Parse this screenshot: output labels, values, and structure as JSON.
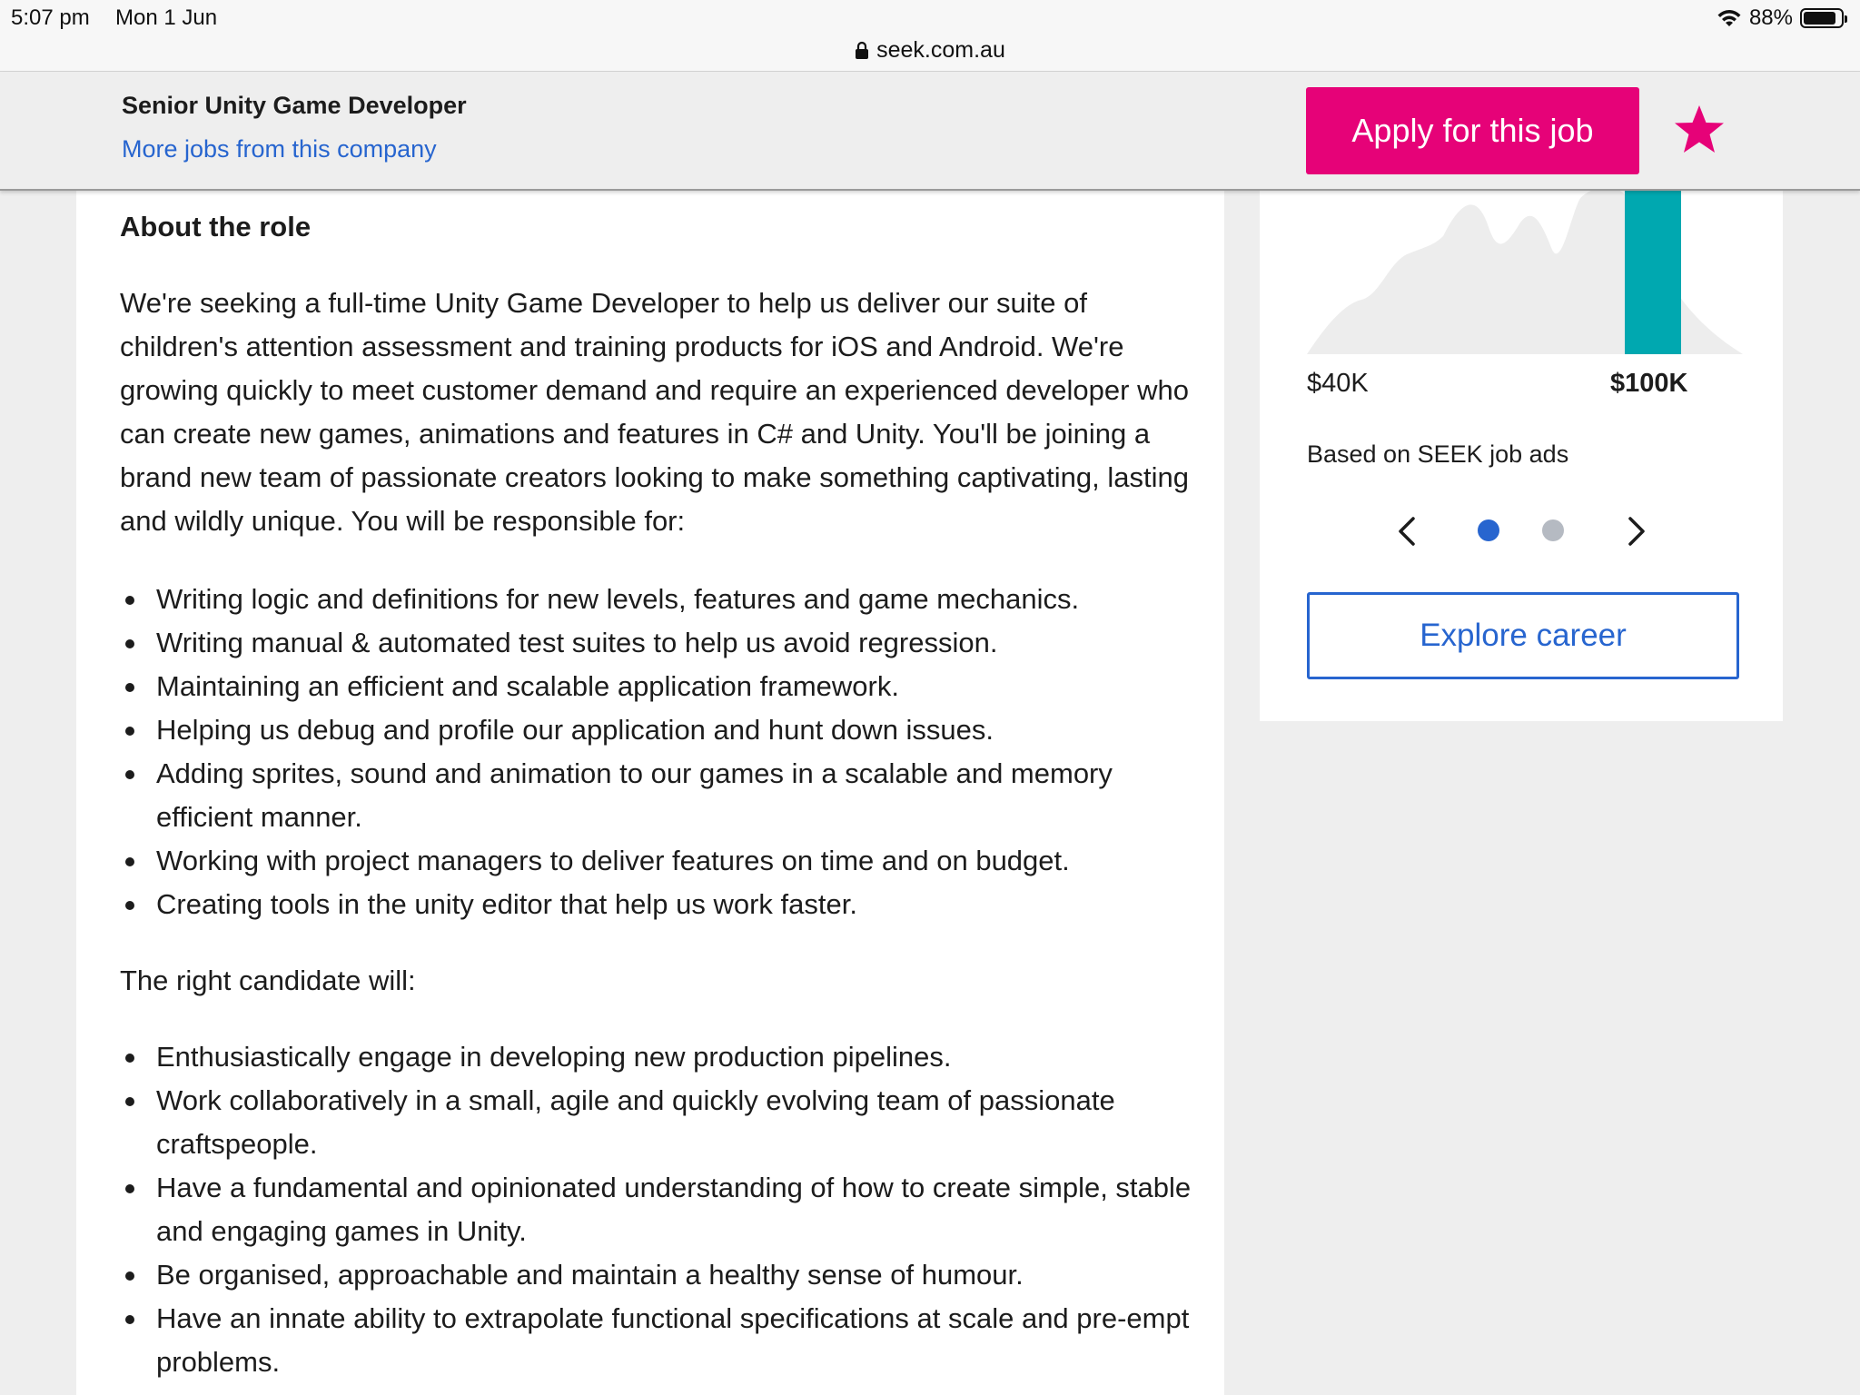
{
  "status_bar": {
    "time": "5:07 pm",
    "date": "Mon 1 Jun",
    "battery": "88%",
    "battery_level": 0.88,
    "url": "seek.com.au"
  },
  "header": {
    "job_title": "Senior Unity Game Developer",
    "company_link": "More jobs from this company",
    "apply_label": "Apply for this job",
    "accent_color": "#e60278",
    "link_color": "#2765cf"
  },
  "content": {
    "section_title": "About the role",
    "intro": "We're seeking a full-time Unity Game Developer to help us deliver our suite of children's attention assessment and training products for iOS and Android. We're growing quickly to meet customer demand and require an experienced developer who can create new games, animations and features in C# and Unity. You'll be joining a brand new team of passionate creators looking to make something captivating, lasting and wildly unique. You will be responsible for:",
    "responsibilities": [
      "Writing logic and definitions for new levels, features and game mechanics.",
      "Writing manual & automated test suites to help us avoid regression.",
      "Maintaining an efficient and scalable application framework.",
      "Helping us debug and profile our application and hunt down issues.",
      "Adding sprites, sound and animation to our games in a scalable and memory efficient manner.",
      "Working with project managers to deliver features on time and on budget.",
      "Creating tools in the unity editor that help us work faster."
    ],
    "candidate_intro": "The right candidate will:",
    "candidate_points": [
      "Enthusiastically engage in developing new production pipelines.",
      "Work collaboratively in a small, agile and quickly evolving team of passionate craftspeople.",
      "Have a fundamental and opinionated understanding of how to create simple, stable and engaging games in Unity.",
      "Be organised, approachable and maintain a healthy sense of humour.",
      "Have an innate ability to extrapolate functional specifications at scale and pre-empt problems."
    ]
  },
  "salary_panel": {
    "low_label": "$40K",
    "high_label": "$100K",
    "source": "Based on SEEK job ads",
    "explore_label": "Explore career",
    "highlight_color": "#00a8b0",
    "distribution_color": "#ececec",
    "carousel_active": 1,
    "carousel_total": 2
  }
}
